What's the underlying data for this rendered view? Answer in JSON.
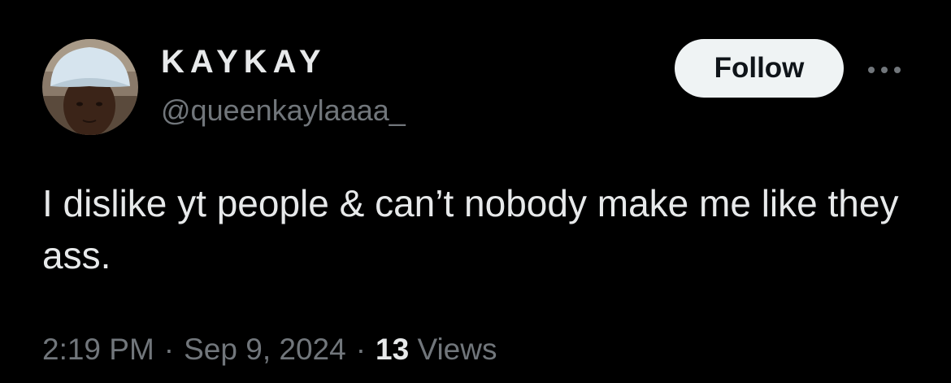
{
  "author": {
    "display_name": "KAYKAY",
    "handle": "@queenkaylaaaa_",
    "avatar_icon": "profile-photo"
  },
  "actions": {
    "follow_label": "Follow",
    "more_icon": "more-horizontal-icon"
  },
  "tweet": {
    "text": "I dislike yt people & can’t nobody make me like they ass."
  },
  "meta": {
    "time": "2:19 PM",
    "separator": "·",
    "date": "Sep 9, 2024",
    "views_count": "13",
    "views_label": "Views"
  },
  "colors": {
    "background": "#000000",
    "primary_text": "#e7e9ea",
    "secondary_text": "#71767b",
    "follow_button_bg": "#eff3f4",
    "follow_button_text": "#0f1419"
  }
}
